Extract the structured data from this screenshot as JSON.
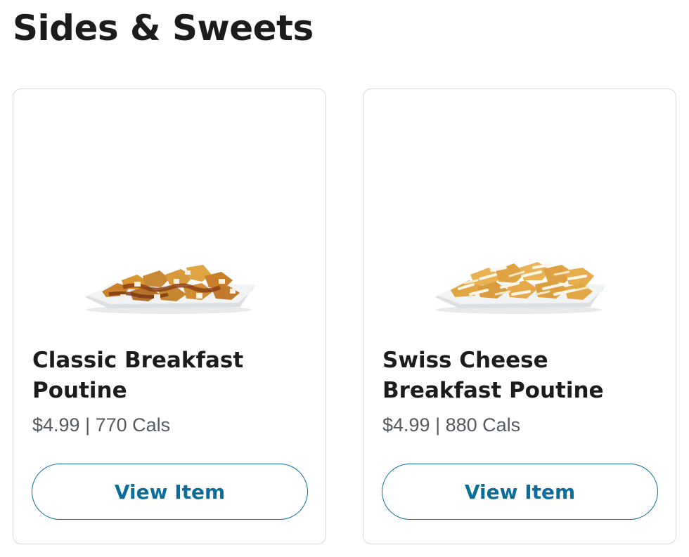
{
  "section": {
    "title": "Sides & Sweets"
  },
  "items": [
    {
      "name": "Classic Breakfast Poutine",
      "meta": "$4.99 | 770 Cals",
      "button_label": "View Item",
      "image_icon": "poutine-gravy-image"
    },
    {
      "name": "Swiss Cheese Breakfast Poutine",
      "meta": "$4.99 | 880 Cals",
      "button_label": "View Item",
      "image_icon": "poutine-cheese-image"
    }
  ],
  "colors": {
    "title_text": "#1c1c1c",
    "meta_text": "#555a5f",
    "button_accent": "#0a6e9c",
    "card_border": "#d9d9d9"
  }
}
